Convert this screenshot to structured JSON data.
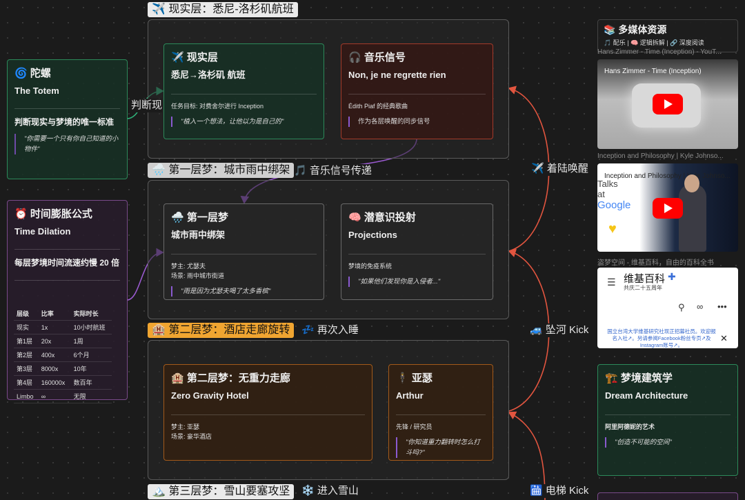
{
  "groups": {
    "reality": {
      "label": "✈️ 现实层：悉尼-洛杉矶航班"
    },
    "dream1": {
      "label": "🌧️ 第一层梦：城市雨中绑架"
    },
    "dream2": {
      "label": "🏨 第二层梦：酒店走廊旋转"
    },
    "dream3": {
      "label": "🏔️ 第三层梦：雪山要塞攻坚"
    }
  },
  "edges": {
    "judge": "判断现实",
    "music": "🎵 音乐信号传递",
    "landing": "✈️ 着陆唤醒",
    "river": "🚙 坠河 Kick",
    "sleep_again": "💤 再次入睡",
    "elevator": "🛗 电梯 Kick",
    "snow": "❄️ 进入雪山"
  },
  "totem": {
    "title": "🌀 陀螺",
    "subtitle": "The Totem",
    "text": "判断现实与梦境的唯一标准",
    "quote": "\"你需要一个只有你自己知道的小物件\""
  },
  "dilation": {
    "title": "⏰ 时间膨胀公式",
    "subtitle": "Time Dilation",
    "text": "每层梦境时间流速约慢 20 倍",
    "table": {
      "headers": [
        "层级",
        "比率",
        "实际时长"
      ],
      "rows": [
        [
          "现实",
          "1x",
          "10小时航班"
        ],
        [
          "第1层",
          "20x",
          "1周"
        ],
        [
          "第2层",
          "400x",
          "6个月"
        ],
        [
          "第3层",
          "8000x",
          "10年"
        ],
        [
          "第4层",
          "160000x",
          "数百年"
        ],
        [
          "Limbo",
          "∞",
          "无限"
        ]
      ]
    }
  },
  "reality_card": {
    "title": "✈️ 现实层",
    "subtitle": "悉尼→洛杉矶 航班",
    "line1": "任务目标: 对费舍尔进行 Inception",
    "quote": "\"植入一个想法，让他以为是自己的\""
  },
  "music_card": {
    "title": "🎧 音乐信号",
    "subtitle": "Non, je ne regrette rien",
    "line1": "Édith Piaf 的经典歌曲",
    "quote": "作为各层唤醒的同步信号"
  },
  "dream1_card": {
    "title": "🌧️ 第一层梦",
    "subtitle": "城市雨中绑架",
    "line1": "梦主: 尤瑟夫",
    "line2": "场景: 雨中城市街道",
    "quote": "\"雨是因为尤瑟夫喝了太多香槟\""
  },
  "proj_card": {
    "title": "🧠 潜意识投射",
    "subtitle": "Projections",
    "line1": "梦境的免疫系统",
    "quote": "\"如果他们发现你是入侵者...\""
  },
  "dream2_card": {
    "title": "🏨 第二层梦：无重力走廊",
    "subtitle": "Zero Gravity Hotel",
    "line1": "梦主: 亚瑟",
    "line2": "场景: 豪华酒店"
  },
  "arthur_card": {
    "title": "🕴️ 亚瑟",
    "subtitle": "Arthur",
    "line1": "先锋 / 研究员",
    "quote": "\"你知道重力翻转时怎么打斗吗?\""
  },
  "media": {
    "title": "📚 多媒体资源",
    "tags": "🎵 配乐 | 🧠 逻辑拆解 | 🔗 深度阅读",
    "video1_caption": "Hans Zimmer - Time (Inception) - YouT...",
    "video1_title": "Hans Zimmer - Time (Inception)",
    "video2_caption": "Inception and Philosophy | Kyle Johnso...",
    "video2_title": "Inception and Philosophy | Kyle Johnso...",
    "video2_brand1": "Talks",
    "video2_brand2": "at",
    "video2_brand3": "Google",
    "wiki_caption": "盗梦空间 - 维基百科，自由的百科全书",
    "wiki_logo": "维基百科",
    "wiki_tagline": "共庆二十五周年",
    "wiki_notice": "国立台湾大学维基研究社现正招募社员。欢迎报名入社↗。另请参阅Facebook粉丝专页↗及Instagram账号↗。"
  },
  "architecture": {
    "title": "🏗️ 梦境建筑学",
    "subtitle": "Dream Architecture",
    "text": "阿里阿德妮的艺术",
    "quote": "\"创造不可能的空间\""
  }
}
